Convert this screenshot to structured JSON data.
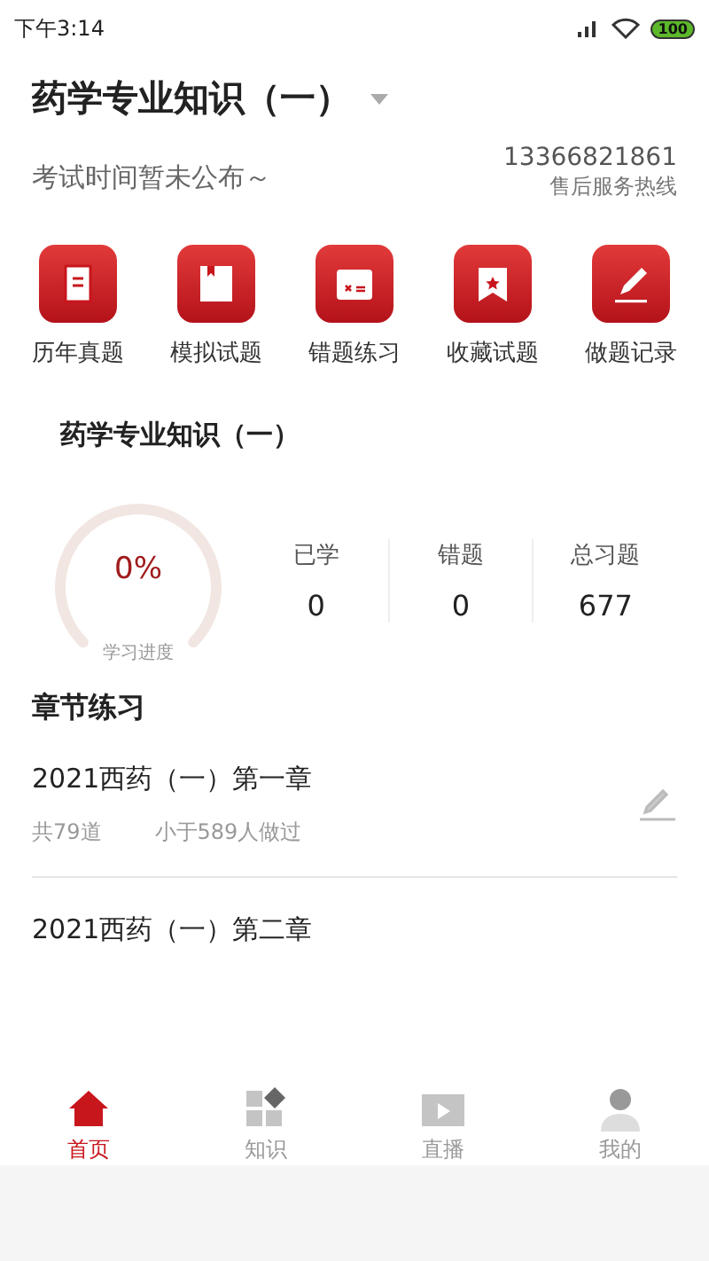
{
  "status_bar": {
    "time": "下午3:14",
    "battery": "100"
  },
  "header": {
    "title": "药学专业知识（一）",
    "exam_note": "考试时间暂未公布～",
    "phone": "13366821861",
    "phone_label": "售后服务热线"
  },
  "shortcuts": [
    {
      "kind": "scroll",
      "label": "历年真题"
    },
    {
      "kind": "book",
      "label": "模拟试题"
    },
    {
      "kind": "calendar",
      "label": "错题练习"
    },
    {
      "kind": "banner",
      "label": "收藏试题"
    },
    {
      "kind": "pencil",
      "label": "做题记录"
    }
  ],
  "progress_card": {
    "title": "药学专业知识（一）",
    "percent": "0%",
    "caption": "学习进度",
    "stats": [
      {
        "label": "已学",
        "value": "0"
      },
      {
        "label": "错题",
        "value": "0"
      },
      {
        "label": "总习题",
        "value": "677"
      }
    ]
  },
  "chapters": {
    "title": "章节练习",
    "items": [
      {
        "title": "2021西药（一）第一章",
        "count": "共79道",
        "done": "小于589人做过"
      },
      {
        "title": "2021西药（一）第二章"
      }
    ]
  },
  "tab_bar": [
    {
      "kind": "home",
      "label": "首页",
      "selected": true
    },
    {
      "kind": "grid",
      "label": "知识",
      "selected": false
    },
    {
      "kind": "video",
      "label": "直播",
      "selected": false
    },
    {
      "kind": "person",
      "label": "我的",
      "selected": false
    }
  ]
}
